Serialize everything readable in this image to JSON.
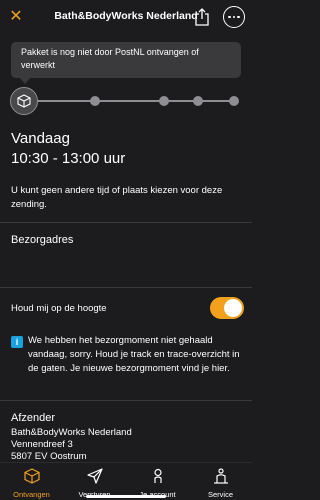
{
  "header": {
    "title": "Bath&BodyWorks Nederland",
    "close_icon": "close-x-icon",
    "share_icon": "share-icon",
    "more_icon": "more-dots-icon"
  },
  "tracking": {
    "status_message": "Pakket is nog niet door PostNL ontvangen of verwerkt",
    "step_total": 5,
    "step_active": 1,
    "active_step_icon": "package-icon"
  },
  "delivery": {
    "date_label": "Vandaag",
    "time_window": "10:30 - 13:00 uur",
    "note": "U kunt geen andere tijd of plaats kiezen voor deze zending."
  },
  "address": {
    "section_title": "Bezorgadres"
  },
  "notify": {
    "label": "Houd mij op de hoogte",
    "enabled": true
  },
  "info": {
    "text": "We hebben het bezorgmoment niet gehaald vandaag, sorry. Houd je track en trace-overzicht in de gaten. Je nieuwe bezorgmoment vind je hier."
  },
  "sender": {
    "section_title": "Afzender",
    "name": "Bath&BodyWorks Nederland",
    "street": "Vennendreef 3",
    "postcode_city": "5807 EV Oostrum"
  },
  "tabbar": {
    "tabs": [
      {
        "label": "Ontvangen",
        "icon": "package-icon",
        "active": true
      },
      {
        "label": "Versturen",
        "icon": "send-icon",
        "active": false
      },
      {
        "label": "Je account",
        "icon": "person-icon",
        "active": false
      },
      {
        "label": "Service",
        "icon": "service-icon",
        "active": false
      }
    ]
  },
  "colors": {
    "accent": "#f3a11c",
    "background": "#1c1c1e",
    "info": "#1aa1e0"
  }
}
